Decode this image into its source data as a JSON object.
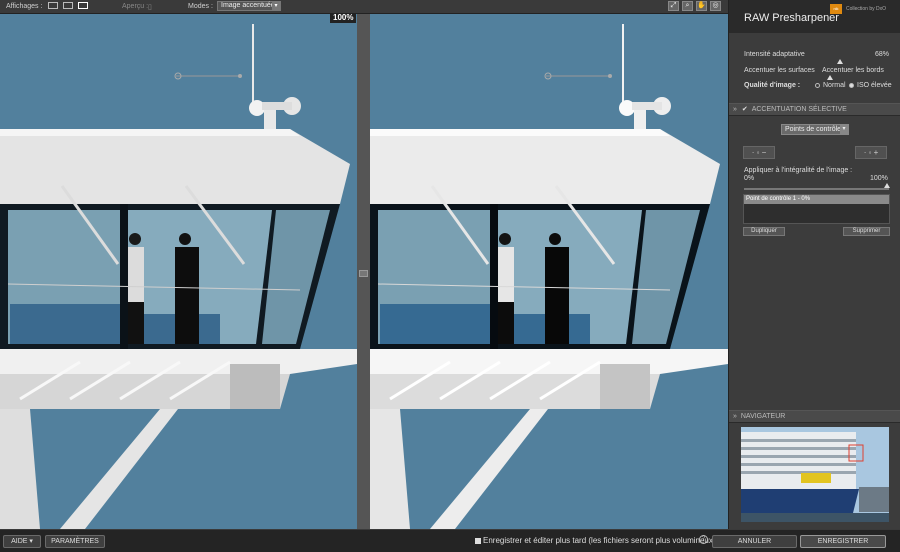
{
  "toolbar": {
    "affichages": "Affichages :",
    "apercu": "Aperçu :",
    "modes": "Modes :",
    "mode_value": "Image accentuée",
    "zoom": "100%"
  },
  "panel": {
    "title": "RAW Presharpener",
    "brand": "Collection by DxO",
    "intensity_label": "Intensité adaptative",
    "intensity_value": "68%",
    "surfaces_label": "Accentuer les surfaces",
    "edges_label": "Accentuer les bords",
    "quality_label": "Qualité d'image :",
    "quality_normal": "Normal",
    "quality_high": "ISO élevée",
    "section_selective": "ACCENTUATION SÉLECTIVE",
    "control_dropdown": "Points de contrôle",
    "apply_label": "Appliquer à l'intégralité de l'image :",
    "apply_min": "0%",
    "apply_max": "100%",
    "control_point_item": "Point de contrôle 1 - 0%",
    "duplicate": "Dupliquer",
    "delete": "Supprimer",
    "section_navigator": "NAVIGATEUR"
  },
  "bottom": {
    "help": "AIDE ▾",
    "settings": "PARAMÈTRES",
    "save_later": "Enregistrer et éditer plus tard (les fichiers seront plus volumineux)",
    "cancel": "ANNULER",
    "save": "ENREGISTRER"
  },
  "colors": {
    "sky": "#52809d",
    "panel": "#3c3c3c",
    "brand": "#e08a10"
  }
}
